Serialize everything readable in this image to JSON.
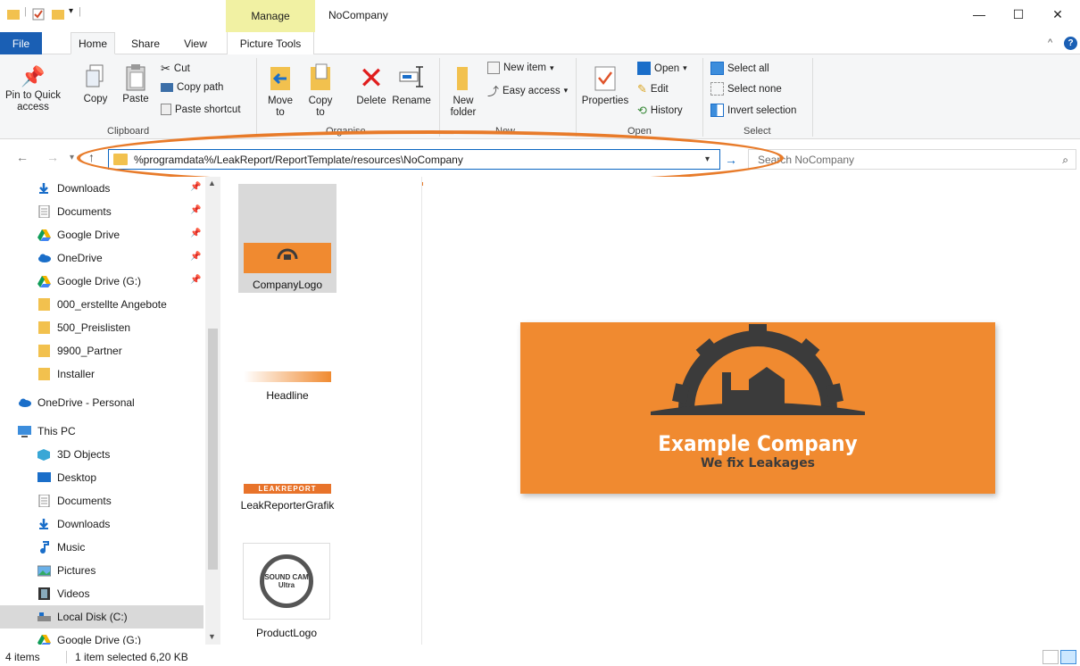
{
  "window": {
    "title": "NoCompany",
    "manage_tab": "Manage",
    "minimize": "—",
    "maximize": "☐",
    "close": "✕"
  },
  "tabs": {
    "file": "File",
    "home": "Home",
    "share": "Share",
    "view": "View",
    "picture_tools": "Picture Tools"
  },
  "ribbon": {
    "clipboard": {
      "group_label": "Clipboard",
      "pin_label": "Pin to Quick access",
      "copy_label": "Copy",
      "paste_label": "Paste",
      "cut_label": "Cut",
      "copy_path_label": "Copy path",
      "paste_shortcut_label": "Paste shortcut"
    },
    "organise": {
      "group_label": "Organise",
      "move_label": "Move to",
      "copyto_label": "Copy to",
      "delete_label": "Delete",
      "rename_label": "Rename"
    },
    "new": {
      "group_label": "New",
      "new_folder_label": "New folder",
      "new_item_label": "New item",
      "easy_access_label": "Easy access"
    },
    "open": {
      "group_label": "Open",
      "properties_label": "Properties",
      "open_label": "Open",
      "edit_label": "Edit",
      "history_label": "History"
    },
    "select": {
      "group_label": "Select",
      "select_all_label": "Select all",
      "select_none_label": "Select none",
      "invert_label": "Invert selection"
    }
  },
  "address": {
    "path": "%programdata%/LeakReport/ReportTemplate/resources\\NoCompany",
    "search_placeholder": "Search NoCompany"
  },
  "sidebar": {
    "items": [
      {
        "label": "Downloads",
        "icon": "download-arrow-icon",
        "pinned": true
      },
      {
        "label": "Documents",
        "icon": "documents-icon",
        "pinned": true
      },
      {
        "label": "Google Drive",
        "icon": "google-drive-icon",
        "pinned": true
      },
      {
        "label": "OneDrive",
        "icon": "onedrive-cloud-icon",
        "pinned": true
      },
      {
        "label": "Google Drive (G:)",
        "icon": "google-drive-icon",
        "pinned": true
      },
      {
        "label": "000_erstellte Angebote",
        "icon": "folder-icon"
      },
      {
        "label": "500_Preislisten",
        "icon": "folder-icon"
      },
      {
        "label": "9900_Partner",
        "icon": "folder-icon"
      },
      {
        "label": "Installer",
        "icon": "folder-icon"
      },
      {
        "label": "OneDrive - Personal",
        "icon": "onedrive-cloud-icon"
      },
      {
        "label": "This PC",
        "icon": "computer-icon"
      },
      {
        "label": "3D Objects",
        "icon": "3d-objects-icon"
      },
      {
        "label": "Desktop",
        "icon": "desktop-icon"
      },
      {
        "label": "Documents",
        "icon": "documents-icon"
      },
      {
        "label": "Downloads",
        "icon": "download-arrow-icon"
      },
      {
        "label": "Music",
        "icon": "music-note-icon"
      },
      {
        "label": "Pictures",
        "icon": "pictures-icon"
      },
      {
        "label": "Videos",
        "icon": "videos-icon"
      },
      {
        "label": "Local Disk (C:)",
        "icon": "local-disk-icon"
      },
      {
        "label": "Google Drive (G:)",
        "icon": "google-drive-icon"
      }
    ]
  },
  "files": [
    {
      "name": "CompanyLogo",
      "selected": true
    },
    {
      "name": "Headline"
    },
    {
      "name": "LeakReporterGrafik",
      "thumb_text": "LEAKREPORT"
    },
    {
      "name": "ProductLogo",
      "thumb_text": "SOUND CAM Ultra"
    }
  ],
  "preview": {
    "company": "Example Company",
    "tagline": "We fix Leakages",
    "colors": {
      "orange": "#f08a30",
      "dark": "#3b3b3b",
      "accent": "#e87b2a"
    }
  },
  "status": {
    "count": "4 items",
    "selection": "1 item selected  6,20 KB"
  }
}
